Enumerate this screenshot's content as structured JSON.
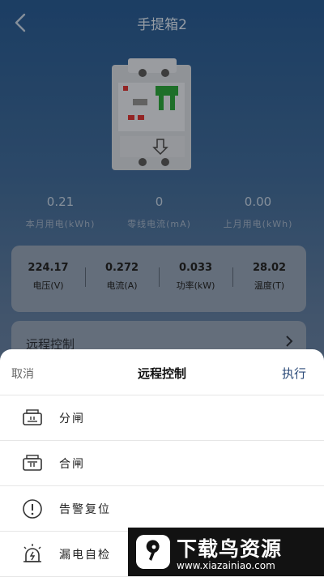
{
  "header": {
    "title": "手提箱2"
  },
  "summary": [
    {
      "value": "0.21",
      "label": "本月用电(kWh)"
    },
    {
      "value": "0",
      "label": "零线电流(mA)"
    },
    {
      "value": "0.00",
      "label": "上月用电(kWh)"
    }
  ],
  "metrics": [
    {
      "value": "224.17",
      "label": "电压(V)"
    },
    {
      "value": "0.272",
      "label": "电流(A)"
    },
    {
      "value": "0.033",
      "label": "功率(kW)"
    },
    {
      "value": "28.02",
      "label": "温度(T)"
    }
  ],
  "remote_row": {
    "label": "远程控制"
  },
  "sheet": {
    "cancel": "取消",
    "title": "远程控制",
    "execute": "执行",
    "options": [
      {
        "label": "分闸",
        "icon": "breaker-open-icon"
      },
      {
        "label": "合闸",
        "icon": "breaker-close-icon"
      },
      {
        "label": "告警复位",
        "icon": "alert-circle-icon"
      },
      {
        "label": "漏电自检",
        "icon": "leak-test-icon"
      }
    ]
  },
  "watermark": {
    "title": "下载鸟资源",
    "url": "www.xiazainiao.com"
  }
}
